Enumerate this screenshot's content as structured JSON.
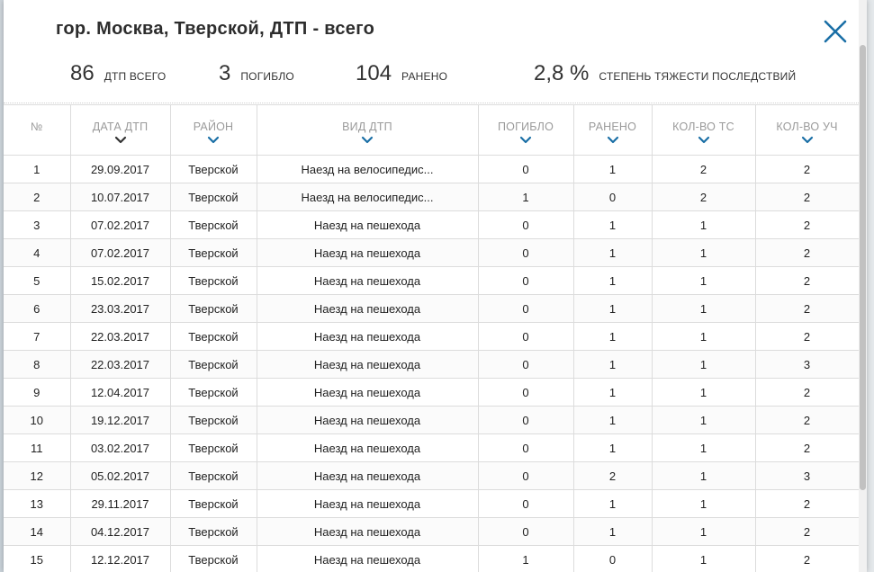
{
  "modal": {
    "title": "гор. Москва, Тверской, ДТП - всего",
    "close_icon": "close-x-icon",
    "accent_color": "#1a6fa6"
  },
  "stats": [
    {
      "value": "86",
      "label": "ДТП ВСЕГО"
    },
    {
      "value": "3",
      "label": "ПОГИБЛО"
    },
    {
      "value": "104",
      "label": "РАНЕНО"
    },
    {
      "value": "2,8 %",
      "label": "СТЕПЕНЬ ТЯЖЕСТИ ПОСЛЕДСТВИЙ"
    }
  ],
  "table": {
    "columns": [
      {
        "label": "№",
        "sort_icon": ""
      },
      {
        "label": "ДАТА ДТП",
        "sort_icon": "chevron-down-dark-icon"
      },
      {
        "label": "РАЙОН",
        "sort_icon": "chevron-down-icon"
      },
      {
        "label": "ВИД ДТП",
        "sort_icon": "chevron-down-icon"
      },
      {
        "label": "ПОГИБЛО",
        "sort_icon": "chevron-down-icon"
      },
      {
        "label": "РАНЕНО",
        "sort_icon": "chevron-down-icon"
      },
      {
        "label": "КОЛ-ВО ТС",
        "sort_icon": "chevron-down-icon"
      },
      {
        "label": "КОЛ-ВО УЧ",
        "sort_icon": "chevron-down-icon"
      }
    ],
    "rows": [
      [
        "1",
        "29.09.2017",
        "Тверской",
        "Наезд на велосипедис...",
        "0",
        "1",
        "2",
        "2"
      ],
      [
        "2",
        "10.07.2017",
        "Тверской",
        "Наезд на велосипедис...",
        "1",
        "0",
        "2",
        "2"
      ],
      [
        "3",
        "07.02.2017",
        "Тверской",
        "Наезд на пешехода",
        "0",
        "1",
        "1",
        "2"
      ],
      [
        "4",
        "07.02.2017",
        "Тверской",
        "Наезд на пешехода",
        "0",
        "1",
        "1",
        "2"
      ],
      [
        "5",
        "15.02.2017",
        "Тверской",
        "Наезд на пешехода",
        "0",
        "1",
        "1",
        "2"
      ],
      [
        "6",
        "23.03.2017",
        "Тверской",
        "Наезд на пешехода",
        "0",
        "1",
        "1",
        "2"
      ],
      [
        "7",
        "22.03.2017",
        "Тверской",
        "Наезд на пешехода",
        "0",
        "1",
        "1",
        "2"
      ],
      [
        "8",
        "22.03.2017",
        "Тверской",
        "Наезд на пешехода",
        "0",
        "1",
        "1",
        "3"
      ],
      [
        "9",
        "12.04.2017",
        "Тверской",
        "Наезд на пешехода",
        "0",
        "1",
        "1",
        "2"
      ],
      [
        "10",
        "19.12.2017",
        "Тверской",
        "Наезд на пешехода",
        "0",
        "1",
        "1",
        "2"
      ],
      [
        "11",
        "03.02.2017",
        "Тверской",
        "Наезд на пешехода",
        "0",
        "1",
        "1",
        "2"
      ],
      [
        "12",
        "05.02.2017",
        "Тверской",
        "Наезд на пешехода",
        "0",
        "2",
        "1",
        "3"
      ],
      [
        "13",
        "29.11.2017",
        "Тверской",
        "Наезд на пешехода",
        "0",
        "1",
        "1",
        "2"
      ],
      [
        "14",
        "04.12.2017",
        "Тверской",
        "Наезд на пешехода",
        "0",
        "1",
        "1",
        "2"
      ],
      [
        "15",
        "12.12.2017",
        "Тверской",
        "Наезд на пешехода",
        "1",
        "0",
        "1",
        "2"
      ]
    ]
  }
}
